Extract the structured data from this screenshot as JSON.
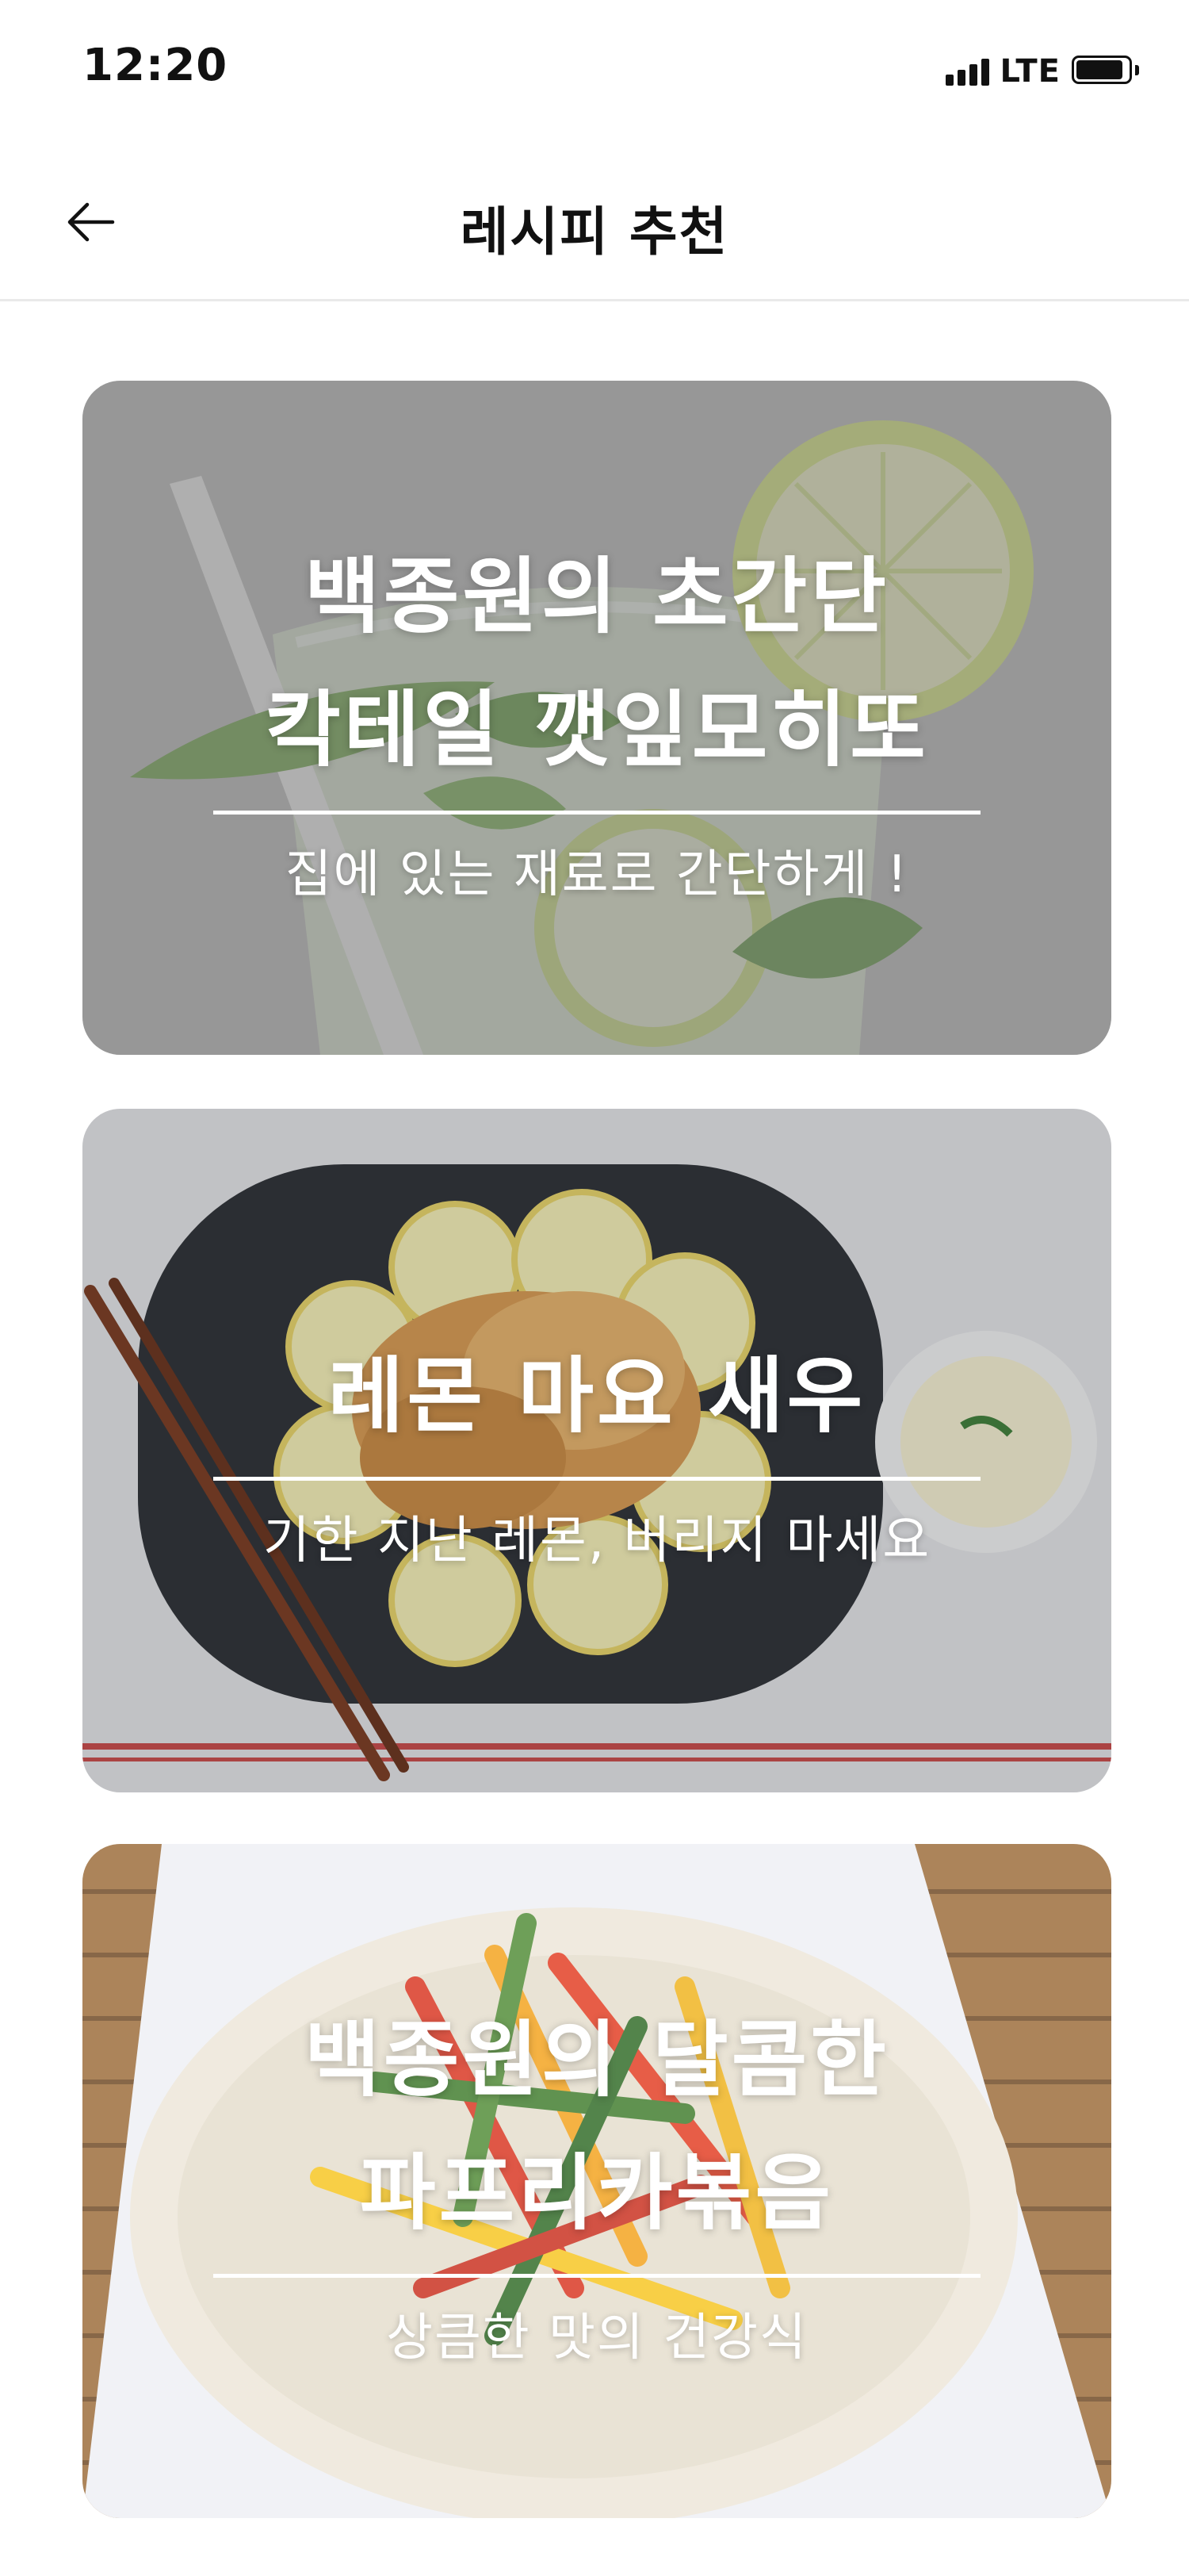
{
  "status_bar": {
    "time": "12:20",
    "network": "LTE"
  },
  "header": {
    "title": "레시피 추천",
    "back_icon": "arrow-left-icon"
  },
  "recipes": [
    {
      "title_lines": [
        "백종원의 초간단",
        "칵테일 깻잎모히또"
      ],
      "subtitle": "집에 있는 재료로 간단하게 !",
      "image": "mojito-glass-with-lemon-and-mint"
    },
    {
      "title_lines": [
        "레몬 마요 새우"
      ],
      "subtitle": "기한 지난 레몬, 버리지 마세요",
      "image": "fried-shrimp-on-lemon-slices-with-chopsticks"
    },
    {
      "title_lines": [
        "백종원의 달콤한",
        "파프리카볶음"
      ],
      "subtitle": "상큼한 맛의 건강식",
      "image": "stir-fried-paprika-on-plate"
    }
  ]
}
